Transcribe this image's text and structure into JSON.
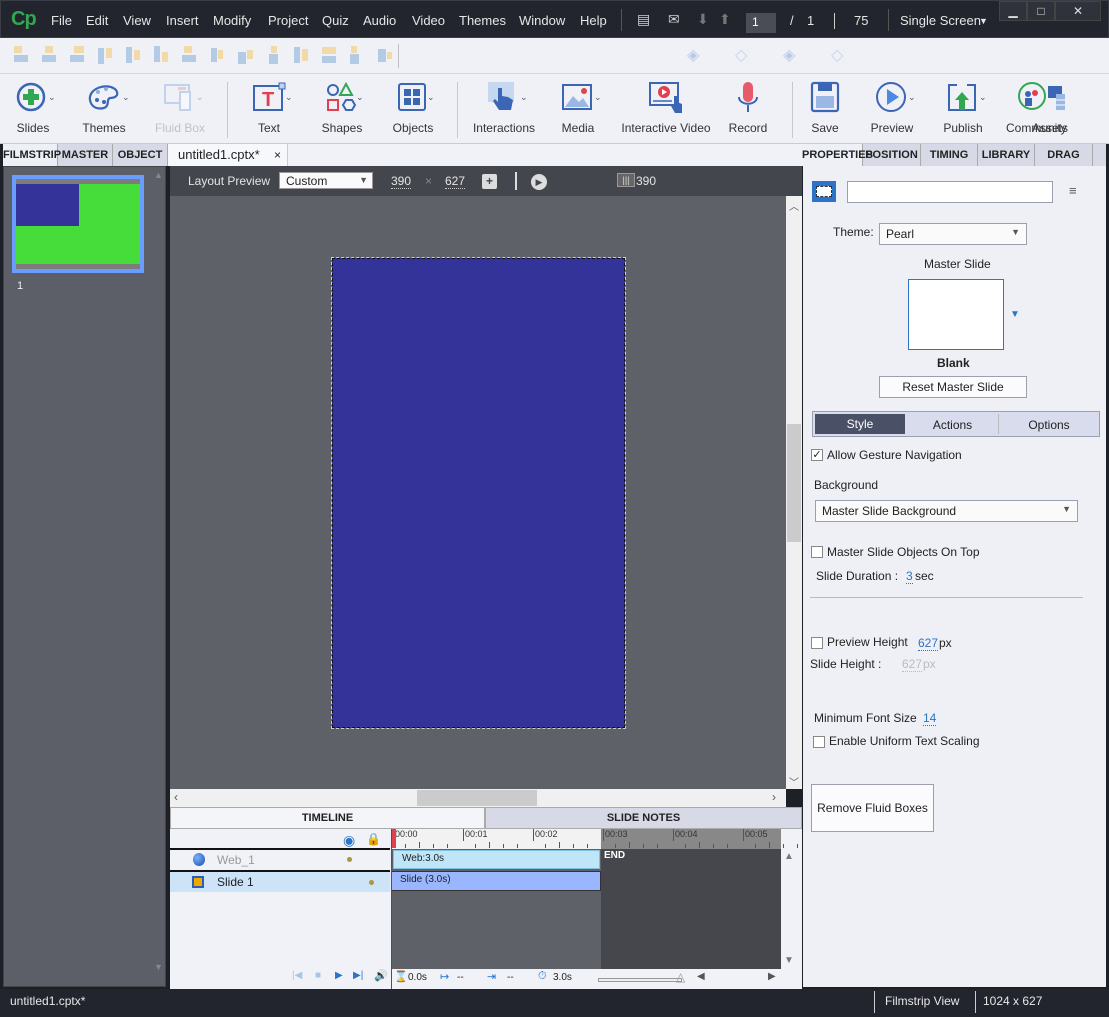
{
  "app": {
    "logo": "Cp"
  },
  "menu": [
    "File",
    "Edit",
    "View",
    "Insert",
    "Modify",
    "Project",
    "Quiz",
    "Audio",
    "Video",
    "Themes",
    "Window",
    "Help"
  ],
  "topbar": {
    "current_page": "1",
    "page_sep": "/",
    "total_pages": "1",
    "zoom": "75",
    "view_mode": "Single Screen"
  },
  "window_controls": {
    "minimize": "▁",
    "maximize": "□",
    "close": "✕"
  },
  "toolbar": [
    {
      "label": "Slides",
      "icon": "add-slide-icon",
      "dropdown": true
    },
    {
      "label": "Themes",
      "icon": "palette-icon",
      "dropdown": true
    },
    {
      "label": "Fluid Box",
      "icon": "fluid-box-icon",
      "dropdown": true,
      "disabled": true
    },
    {
      "label": "Text",
      "icon": "text-icon",
      "dropdown": true
    },
    {
      "label": "Shapes",
      "icon": "shapes-icon",
      "dropdown": true
    },
    {
      "label": "Objects",
      "icon": "objects-icon",
      "dropdown": true
    },
    {
      "label": "Interactions",
      "icon": "hand-pointer-icon",
      "dropdown": true
    },
    {
      "label": "Media",
      "icon": "image-icon",
      "dropdown": true
    },
    {
      "label": "Interactive Video",
      "icon": "interactive-video-icon",
      "dropdown": false
    },
    {
      "label": "Record",
      "icon": "microphone-icon",
      "dropdown": false
    },
    {
      "label": "Save",
      "icon": "floppy-icon",
      "dropdown": false
    },
    {
      "label": "Preview",
      "icon": "play-circle-icon",
      "dropdown": true
    },
    {
      "label": "Publish",
      "icon": "publish-icon",
      "dropdown": true
    },
    {
      "label": "Community",
      "icon": "community-icon",
      "dropdown": false
    },
    {
      "label": "Assets",
      "icon": "assets-icon",
      "dropdown": false
    }
  ],
  "left_tabs": [
    "FILMSTRIP",
    "MASTER ...",
    "OBJECT S..."
  ],
  "filmstrip": {
    "slides": [
      {
        "number": "1"
      }
    ]
  },
  "document": {
    "tab_name": "untitled1.cptx*",
    "close": "×"
  },
  "layout_bar": {
    "label": "Layout Preview",
    "preset": "Custom",
    "width": "390",
    "times": "×",
    "height": "627",
    "ruler_value": "390"
  },
  "right_tabs": [
    "PROPERTIES",
    "POSITION",
    "TIMING",
    "LIBRARY",
    "DRAG AN..."
  ],
  "properties": {
    "name_value": "",
    "theme_label": "Theme:",
    "theme_value": "Pearl",
    "master_slide_label": "Master Slide",
    "master_slide_name": "Blank",
    "reset_button": "Reset Master Slide",
    "subtabs": [
      "Style",
      "Actions",
      "Options"
    ],
    "active_subtab": "Style",
    "allow_gesture": {
      "label": "Allow Gesture Navigation",
      "checked": true
    },
    "background_label": "Background",
    "background_value": "Master Slide Background",
    "master_objects_on_top": {
      "label": "Master Slide Objects On Top",
      "checked": false
    },
    "slide_duration_label": "Slide Duration :",
    "slide_duration_value": "3",
    "slide_duration_unit": "sec",
    "preview_height": {
      "label": "Preview Height",
      "checked": false,
      "value": "627",
      "unit": "px"
    },
    "slide_height_label": "Slide Height :",
    "slide_height_value": "627",
    "slide_height_unit": "px",
    "min_font_label": "Minimum Font Size",
    "min_font_value": "14",
    "uniform_text": {
      "label": "Enable Uniform Text Scaling",
      "checked": false
    },
    "remove_fluid_button": "Remove Fluid Boxes"
  },
  "timeline": {
    "tabs": [
      "TIMELINE",
      "SLIDE NOTES"
    ],
    "ruler": [
      "00:00",
      "00:01",
      "00:02",
      "00:03",
      "00:04",
      "00:05"
    ],
    "layers": [
      {
        "name": "Web_1",
        "bar": "Web:3.0s"
      },
      {
        "name": "Slide 1",
        "bar": "Slide (3.0s)"
      }
    ],
    "end_label": "END",
    "current_time": "0.0s",
    "in_time": "--",
    "out_time": "--",
    "duration": "3.0s"
  },
  "status": {
    "file": "untitled1.cptx*",
    "view": "Filmstrip View",
    "resolution": "1024 x 627"
  },
  "colors": {
    "accent": "#2b74c7",
    "slide_bg": "#333399",
    "thumb_green": "#46dd3a"
  }
}
